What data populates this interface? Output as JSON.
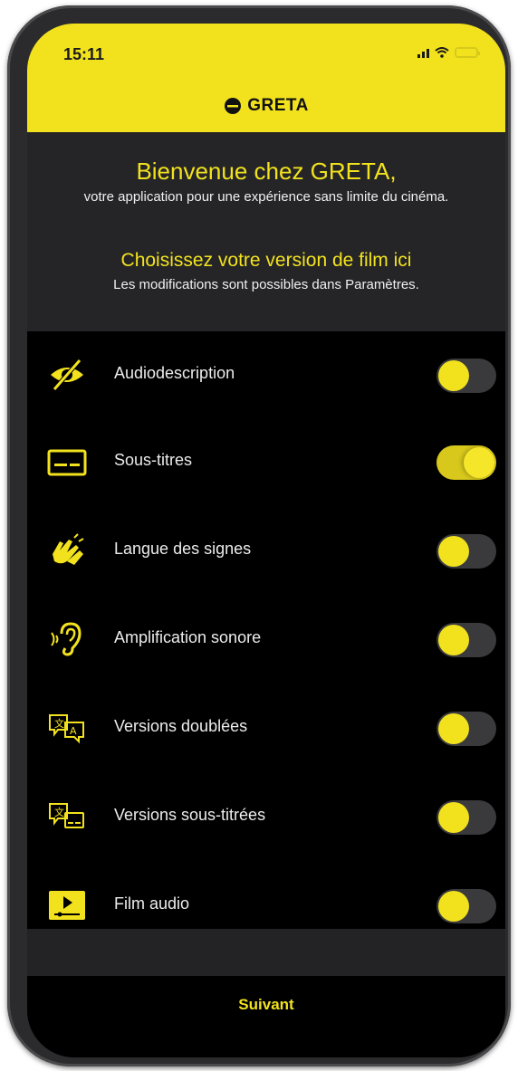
{
  "status_bar": {
    "time": "15:11",
    "icons": [
      "signal-icon",
      "wifi-icon",
      "battery-icon"
    ]
  },
  "header": {
    "logo_text": "GRETA",
    "logo_icon": "greta-logo-icon"
  },
  "intro": {
    "title": "Bienvenue chez GRETA,",
    "subtitle": "votre application pour une expérience sans limite du cinéma.",
    "choose_title": "Choisissez votre version de film ici",
    "choose_subtitle": "Les modifications sont possibles dans Paramètres."
  },
  "options": [
    {
      "label": "Audiodescription",
      "icon": "audiodescription-icon",
      "enabled": false
    },
    {
      "label": "Sous-titres",
      "icon": "subtitles-icon",
      "enabled": true
    },
    {
      "label": "Langue des signes",
      "icon": "sign-language-icon",
      "enabled": false
    },
    {
      "label": "Amplification sonore",
      "icon": "hearing-amplification-icon",
      "enabled": false
    },
    {
      "label": "Versions doublées",
      "icon": "dubbed-versions-icon",
      "enabled": false
    },
    {
      "label": "Versions sous-titrées",
      "icon": "subtitled-versions-icon",
      "enabled": false
    },
    {
      "label": "Film audio",
      "icon": "audio-film-icon",
      "enabled": false
    }
  ],
  "footer": {
    "next_label": "Suivant"
  },
  "colors": {
    "accent": "#f2e21e",
    "background": "#000000",
    "panel": "#252527"
  }
}
